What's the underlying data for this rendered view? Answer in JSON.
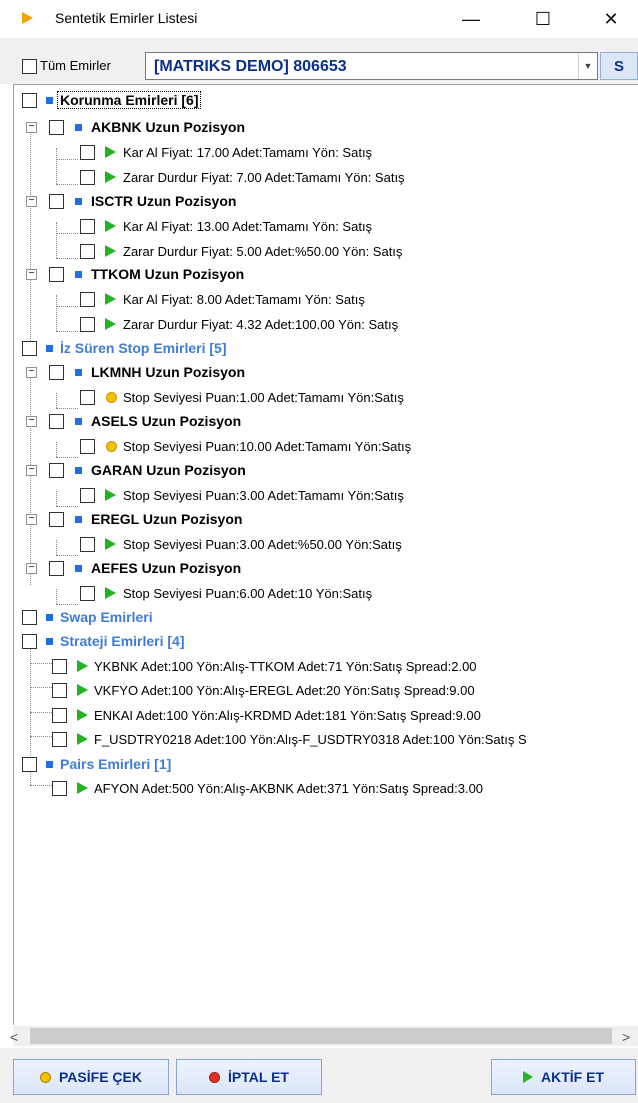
{
  "window": {
    "title": "Sentetik Emirler Listesi",
    "minimize": "—",
    "maximize": "☐",
    "close": "✕"
  },
  "toolbar": {
    "all_orders_label": "Tüm Emirler",
    "account": "[MATRIKS DEMO] 806653",
    "s_button": "S"
  },
  "tree": {
    "r1": "Korunma Emirleri [6]",
    "r2": "AKBNK Uzun Pozisyon",
    "r3": "Kar Al Fiyat: 17.00 Adet:Tamamı Yön: Satış",
    "r4": "Zarar Durdur Fiyat: 7.00 Adet:Tamamı Yön: Satış",
    "r5": "ISCTR Uzun Pozisyon",
    "r6": "Kar Al Fiyat: 13.00 Adet:Tamamı Yön: Satış",
    "r7": "Zarar Durdur Fiyat: 5.00 Adet:%50.00 Yön: Satış",
    "r8": "TTKOM Uzun Pozisyon",
    "r9": "Kar Al Fiyat: 8.00 Adet:Tamamı Yön: Satış",
    "r10": "Zarar Durdur Fiyat: 4.32 Adet:100.00 Yön: Satış",
    "r11": "İz Süren Stop Emirleri [5]",
    "r12": "LKMNH Uzun Pozisyon",
    "r13": "Stop Seviyesi Puan:1.00 Adet:Tamamı Yön:Satış",
    "r14": "ASELS Uzun Pozisyon",
    "r15": "Stop Seviyesi Puan:10.00 Adet:Tamamı Yön:Satış",
    "r16": "GARAN Uzun Pozisyon",
    "r17": "Stop Seviyesi Puan:3.00 Adet:Tamamı Yön:Satış",
    "r18": "EREGL Uzun Pozisyon",
    "r19": "Stop Seviyesi Puan:3.00 Adet:%50.00 Yön:Satış",
    "r20": "AEFES Uzun Pozisyon",
    "r21": "Stop Seviyesi Puan:6.00 Adet:10 Yön:Satış",
    "r22": "Swap Emirleri",
    "r23": "Strateji Emirleri [4]",
    "r24": "YKBNK Adet:100 Yön:Alış-TTKOM Adet:71 Yön:Satış  Spread:2.00",
    "r25": "VKFYO Adet:100 Yön:Alış-EREGL Adet:20 Yön:Satış  Spread:9.00",
    "r26": "ENKAI Adet:100 Yön:Alış-KRDMD Adet:181 Yön:Satış  Spread:9.00",
    "r27": "F_USDTRY0218 Adet:100 Yön:Alış-F_USDTRY0318 Adet:100 Yön:Satış  S",
    "r28": "Pairs Emirleri [1]",
    "r29": "AFYON Adet:500 Yön:Alış-AKBNK Adet:371 Yön:Satış  Spread:3.00"
  },
  "scroll": {
    "left": "<",
    "right": ">"
  },
  "buttons": {
    "passive": "PASİFE ÇEK",
    "cancel": "İPTAL ET",
    "activate": "AKTİF ET"
  },
  "colors": {
    "accent": "#0c2f8a",
    "blue_group": "#3f7cd6",
    "green_icon": "#23b323",
    "yellow_icon": "#f3c000",
    "red_icon": "#e03020"
  }
}
